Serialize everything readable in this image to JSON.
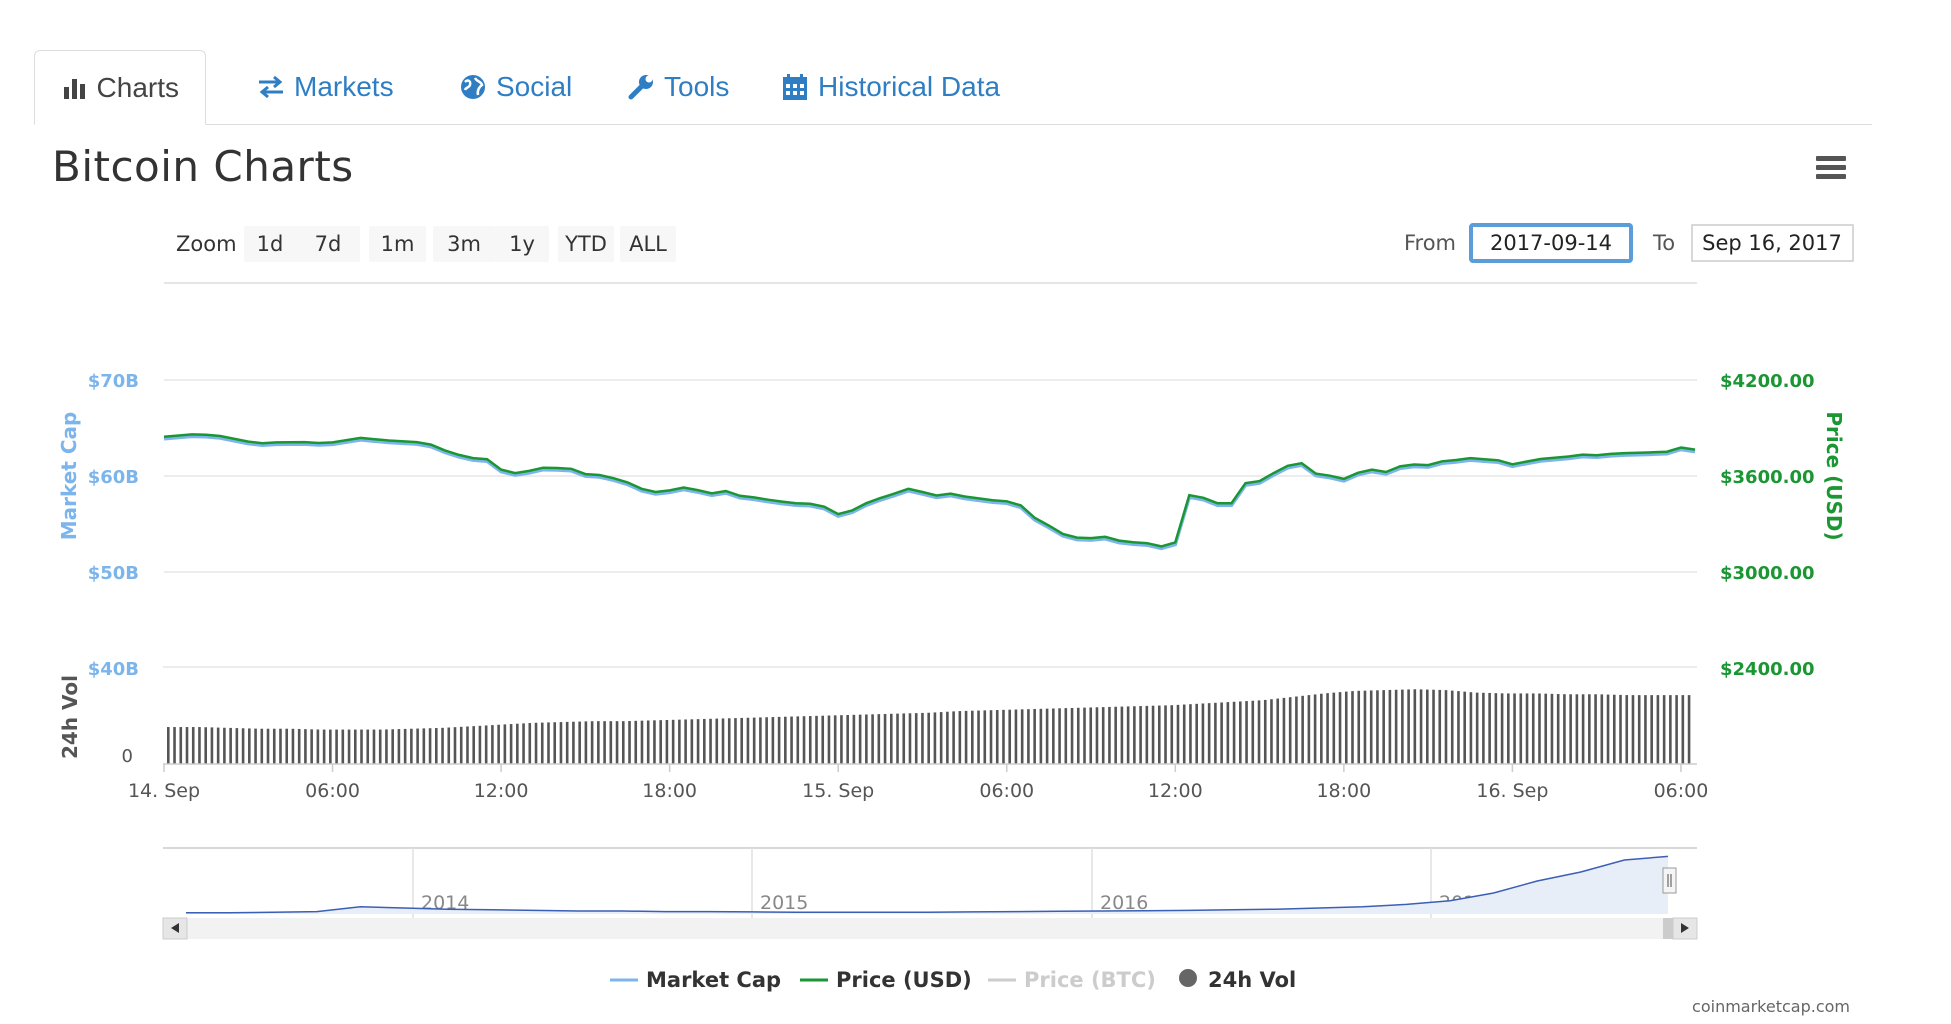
{
  "tabs": [
    {
      "label": "Charts",
      "icon": "bar-chart-icon",
      "active": true
    },
    {
      "label": "Markets",
      "icon": "exchange-arrows-icon",
      "active": false
    },
    {
      "label": "Social",
      "icon": "globe-icon",
      "active": false
    },
    {
      "label": "Tools",
      "icon": "wrench-icon",
      "active": false
    },
    {
      "label": "Historical Data",
      "icon": "calendar-icon",
      "active": false
    }
  ],
  "page": {
    "title": "Bitcoin Charts",
    "menu_icon": "hamburger-menu-icon"
  },
  "range_selector": {
    "zoom_label": "Zoom",
    "buttons": [
      "1d",
      "7d",
      "1m",
      "3m",
      "1y",
      "YTD",
      "ALL"
    ],
    "from_label": "From",
    "from_value": "2017-09-14",
    "to_label": "To",
    "to_value": "Sep 16, 2017"
  },
  "chart_data": {
    "type": "line",
    "title": "",
    "x_ticks": [
      "14. Sep",
      "06:00",
      "12:00",
      "18:00",
      "15. Sep",
      "06:00",
      "12:00",
      "18:00",
      "16. Sep",
      "06:00"
    ],
    "left_axis": {
      "label": "Market Cap",
      "ticks": [
        "$70B",
        "$60B",
        "$50B",
        "$40B"
      ],
      "ylim": [
        40,
        70
      ],
      "unit": "$B"
    },
    "right_axis": {
      "label": "Price (USD)",
      "ticks": [
        "$4200.00",
        "$3600.00",
        "$3000.00",
        "$2400.00"
      ],
      "ylim": [
        2400,
        4200
      ]
    },
    "volume_axis": {
      "label": "24h Vol",
      "ticks": [
        "0"
      ]
    },
    "series": [
      {
        "name": "Price (USD)",
        "color": "#1a9633",
        "x_hours": [
          0,
          1,
          1.5,
          2,
          3,
          3.5,
          4,
          5,
          5.5,
          6,
          7,
          7.5,
          8,
          9,
          9.5,
          10,
          10.5,
          11,
          11.5,
          12,
          12.5,
          13,
          13.5,
          14,
          14.5,
          15,
          15.5,
          16,
          16.5,
          17,
          17.5,
          18,
          18.5,
          19,
          19.5,
          20,
          20.5,
          21,
          21.5,
          22,
          22.5,
          23,
          23.5,
          24,
          24.5,
          25,
          25.5,
          26,
          26.5,
          27,
          27.5,
          28,
          28.5,
          29,
          29.5,
          30,
          30.5,
          31,
          31.5,
          32,
          32.5,
          33,
          33.5,
          34,
          34.5,
          35,
          35.5,
          36,
          36.5,
          37,
          37.5,
          38,
          38.5,
          39,
          39.5,
          40,
          40.5,
          41,
          41.5,
          42,
          42.5,
          43,
          43.5,
          44,
          44.5,
          45,
          45.5,
          46,
          46.5,
          47,
          47.5,
          48,
          48.5,
          49,
          49.5,
          50,
          50.5,
          51,
          51.5,
          52,
          52.5,
          53,
          53.5,
          54,
          54.5
        ],
        "values": [
          3845,
          3860,
          3858,
          3850,
          3815,
          3805,
          3810,
          3812,
          3806,
          3810,
          3838,
          3830,
          3822,
          3812,
          3796,
          3760,
          3732,
          3712,
          3705,
          3640,
          3618,
          3632,
          3652,
          3650,
          3645,
          3612,
          3606,
          3586,
          3560,
          3520,
          3500,
          3510,
          3528,
          3512,
          3492,
          3506,
          3476,
          3466,
          3452,
          3440,
          3430,
          3426,
          3408,
          3362,
          3385,
          3430,
          3462,
          3490,
          3520,
          3500,
          3478,
          3490,
          3472,
          3460,
          3448,
          3442,
          3416,
          3338,
          3290,
          3238,
          3215,
          3212,
          3220,
          3196,
          3186,
          3180,
          3160,
          3185,
          3480,
          3464,
          3430,
          3430,
          3555,
          3568,
          3618,
          3664,
          3680,
          3615,
          3602,
          3582,
          3620,
          3640,
          3625,
          3660,
          3672,
          3668,
          3692,
          3700,
          3712,
          3705,
          3698,
          3673,
          3690,
          3706,
          3714,
          3722,
          3734,
          3730,
          3738,
          3743,
          3745,
          3748,
          3752,
          3778,
          3765
        ]
      },
      {
        "name": "Market Cap",
        "color": "#7cb5ec",
        "note_values_follow_price": true
      },
      {
        "name": "Price (BTC)",
        "color": "#cccccc",
        "hidden": true
      },
      {
        "name": "24h Vol",
        "color": "#555555"
      }
    ],
    "volume_relative": [
      0.44,
      0.44,
      0.43,
      0.42,
      0.42,
      0.41,
      0.41,
      0.41,
      0.42,
      0.43,
      0.45,
      0.47,
      0.49,
      0.5,
      0.51,
      0.51,
      0.52,
      0.53,
      0.54,
      0.55,
      0.56,
      0.57,
      0.58,
      0.59,
      0.6,
      0.61,
      0.63,
      0.64,
      0.65,
      0.66,
      0.67,
      0.68,
      0.69,
      0.7,
      0.72,
      0.74,
      0.76,
      0.8,
      0.84,
      0.87,
      0.88,
      0.89,
      0.88,
      0.85,
      0.84,
      0.84,
      0.83,
      0.83,
      0.82,
      0.82,
      0.82
    ],
    "grid": true,
    "legend_position": "bottom-center",
    "navigator": {
      "years": [
        "2014",
        "2015",
        "2016",
        "2017"
      ],
      "relative_values": [
        0.02,
        0.02,
        0.03,
        0.04,
        0.12,
        0.1,
        0.08,
        0.07,
        0.06,
        0.05,
        0.05,
        0.04,
        0.04,
        0.035,
        0.03,
        0.03,
        0.03,
        0.03,
        0.035,
        0.04,
        0.045,
        0.05,
        0.055,
        0.06,
        0.07,
        0.08,
        0.1,
        0.12,
        0.16,
        0.22,
        0.35,
        0.55,
        0.7,
        0.9,
        0.96
      ]
    }
  },
  "legend": [
    {
      "label": "Market Cap",
      "color": "#7cb5ec",
      "symbol": "line"
    },
    {
      "label": "Price (USD)",
      "color": "#1a9633",
      "symbol": "line"
    },
    {
      "label": "Price (BTC)",
      "color": "#cccccc",
      "symbol": "line",
      "hidden": true
    },
    {
      "label": "24h Vol",
      "color": "#666666",
      "symbol": "dot"
    }
  ],
  "credit": "coinmarketcap.com"
}
